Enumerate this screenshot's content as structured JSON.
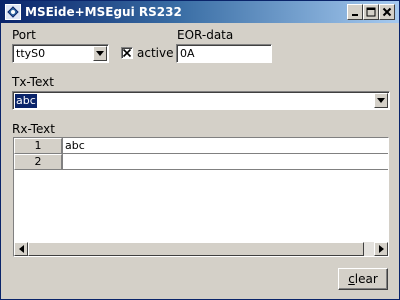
{
  "window": {
    "title": "MSEide+MSEgui RS232",
    "titlebar_colors": [
      "#0a246a",
      "#a6caf0"
    ]
  },
  "port": {
    "label": "Port",
    "value": "ttyS0"
  },
  "active": {
    "label": "active",
    "checked": true
  },
  "eor": {
    "label": "EOR-data",
    "value": "0A"
  },
  "tx": {
    "label": "Tx-Text",
    "value": "abc"
  },
  "rx": {
    "label": "Rx-Text",
    "rows": [
      {
        "num": "1",
        "text": "abc"
      },
      {
        "num": "2",
        "text": ""
      }
    ]
  },
  "buttons": {
    "clear_first": "c",
    "clear_rest": "lear"
  },
  "icons": {
    "app": "app-icon",
    "minimize": "minimize-icon",
    "maximize": "maximize-icon",
    "close": "close-icon",
    "dropdown": "chevron-down-icon",
    "scroll_left": "arrow-left-icon",
    "scroll_right": "arrow-right-icon"
  }
}
